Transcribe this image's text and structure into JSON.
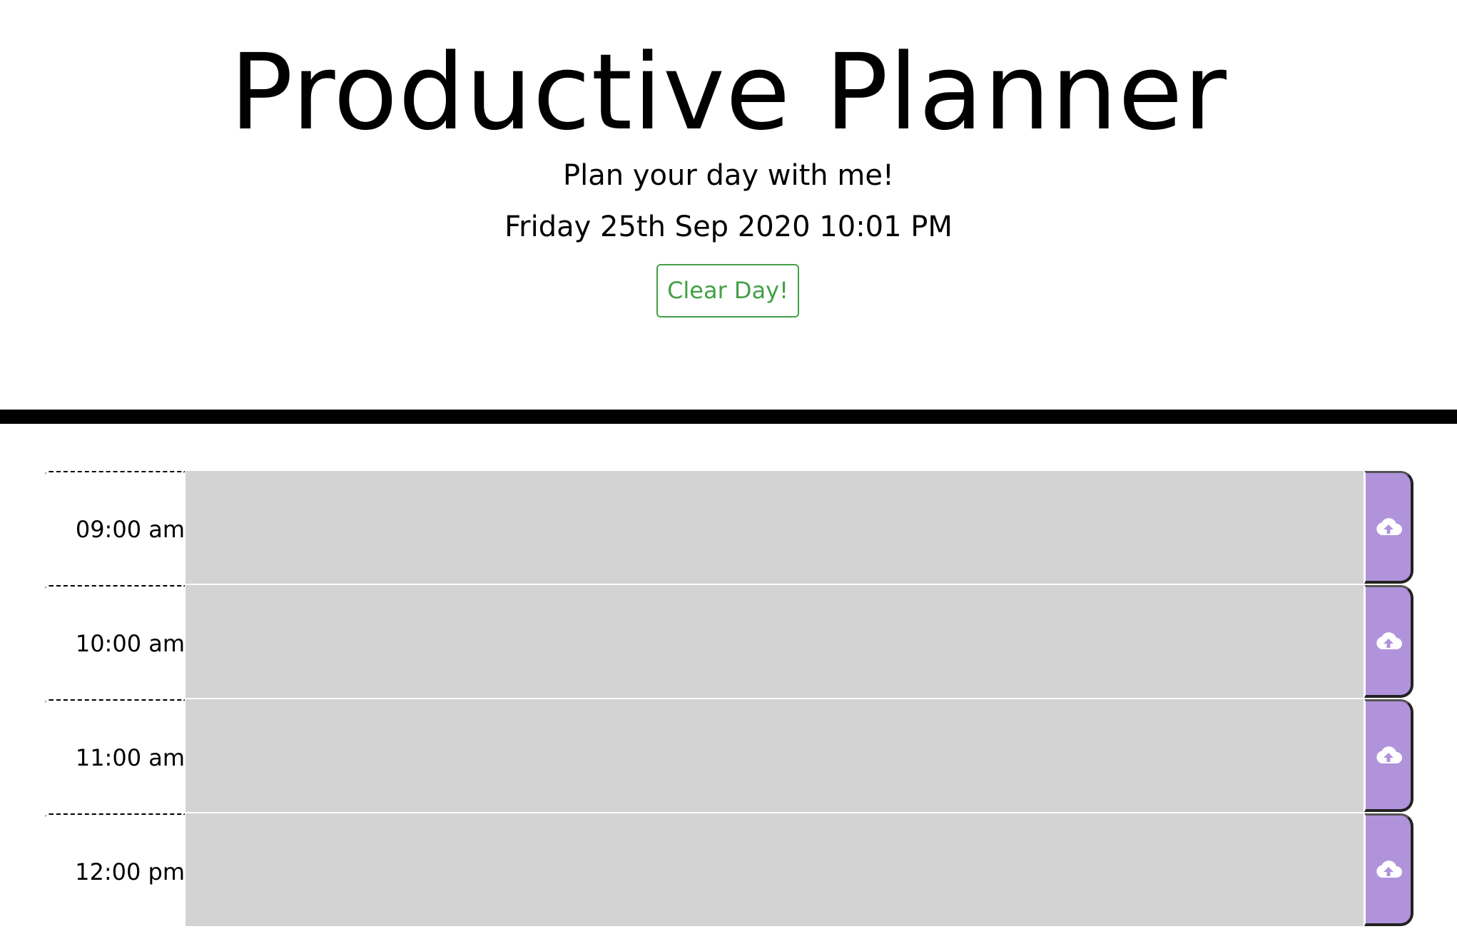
{
  "header": {
    "title": "Productive Planner",
    "subtitle": "Plan your day with me!",
    "current_datetime": "Friday 25th Sep 2020 10:01 PM",
    "clear_button_label": "Clear Day!"
  },
  "timeblocks": [
    {
      "hour_label": "09:00 am",
      "entry_text": "",
      "save_icon": "cloud-upload-icon"
    },
    {
      "hour_label": "10:00 am",
      "entry_text": "",
      "save_icon": "cloud-upload-icon"
    },
    {
      "hour_label": "11:00 am",
      "entry_text": "",
      "save_icon": "cloud-upload-icon"
    },
    {
      "hour_label": "12:00 pm",
      "entry_text": "",
      "save_icon": "cloud-upload-icon"
    }
  ],
  "colors": {
    "past_block": "#d3d3d3",
    "save_button": "#b193dc",
    "clear_button": "#43a047",
    "divider": "#000000"
  }
}
